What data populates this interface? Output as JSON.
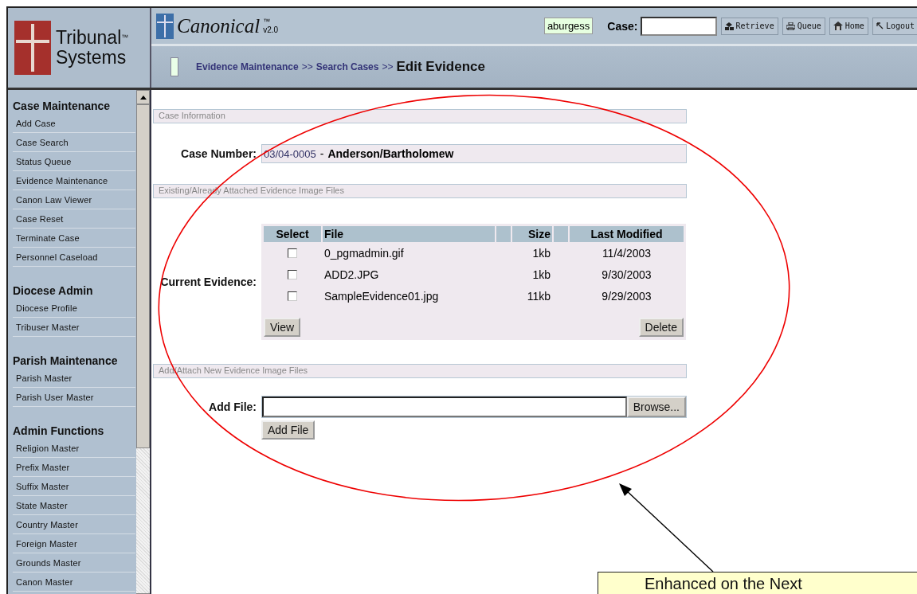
{
  "logo": {
    "line_1": "Tribunal",
    "line_2": "Systems",
    "trademark": "™"
  },
  "app": {
    "name": "Canonical",
    "trademark": "™",
    "version": "v2.0"
  },
  "user": "aburgess",
  "case_field": {
    "label": "Case:"
  },
  "toolbar": [
    {
      "kind": "retrieve",
      "label": "Retrieve"
    },
    {
      "kind": "queue",
      "label": "Queue"
    },
    {
      "kind": "home",
      "label": "Home"
    },
    {
      "kind": "logout",
      "label": "Logout"
    }
  ],
  "breadcrumb": {
    "links": [
      "Evidence Maintenance",
      "Search Cases"
    ],
    "separator": ">>",
    "current": "Edit Evidence"
  },
  "sidebar": [
    {
      "title": "Case Maintenance",
      "items": [
        "Add Case",
        "Case Search",
        "Status Queue",
        "Evidence Maintenance",
        "Canon Law Viewer",
        "Case Reset",
        "Terminate Case",
        "Personnel Caseload"
      ]
    },
    {
      "title": "Diocese Admin",
      "items": [
        "Diocese Profile",
        "Tribuser Master"
      ]
    },
    {
      "title": "Parish Maintenance",
      "items": [
        "Parish Master",
        "Parish User Master"
      ]
    },
    {
      "title": "Admin Functions",
      "items": [
        "Religion Master",
        "Prefix Master",
        "Suffix Master",
        "State Master",
        "Country Master",
        "Foreign Master",
        "Grounds Master",
        "Canon Master"
      ]
    }
  ],
  "sections": {
    "case_info": "Case Information",
    "existing": "Existing/Already Attached Evidence Image Files",
    "add_new": "Add/Attach New Evidence Image Files"
  },
  "case_number": {
    "label": "Case Number:",
    "number": "03/04-0005",
    "separator": "-",
    "name": "Anderson/Bartholomew"
  },
  "evidence": {
    "label": "Current Evidence:",
    "columns": [
      "Select",
      "File",
      "Size",
      "Last Modified"
    ],
    "rows": [
      {
        "checked": false,
        "file": "0_pgmadmin.gif",
        "size": "1kb",
        "modified": "11/4/2003"
      },
      {
        "checked": false,
        "file": "ADD2.JPG",
        "size": "1kb",
        "modified": "9/30/2003"
      },
      {
        "checked": false,
        "file": "SampleEvidence01.jpg",
        "size": "11kb",
        "modified": "9/29/2003"
      }
    ],
    "buttons": [
      "View",
      "Delete"
    ]
  },
  "add_file": {
    "label": "Add File:",
    "browse": "Browse...",
    "submit": "Add File"
  },
  "callout": "Enhanced on the Next"
}
